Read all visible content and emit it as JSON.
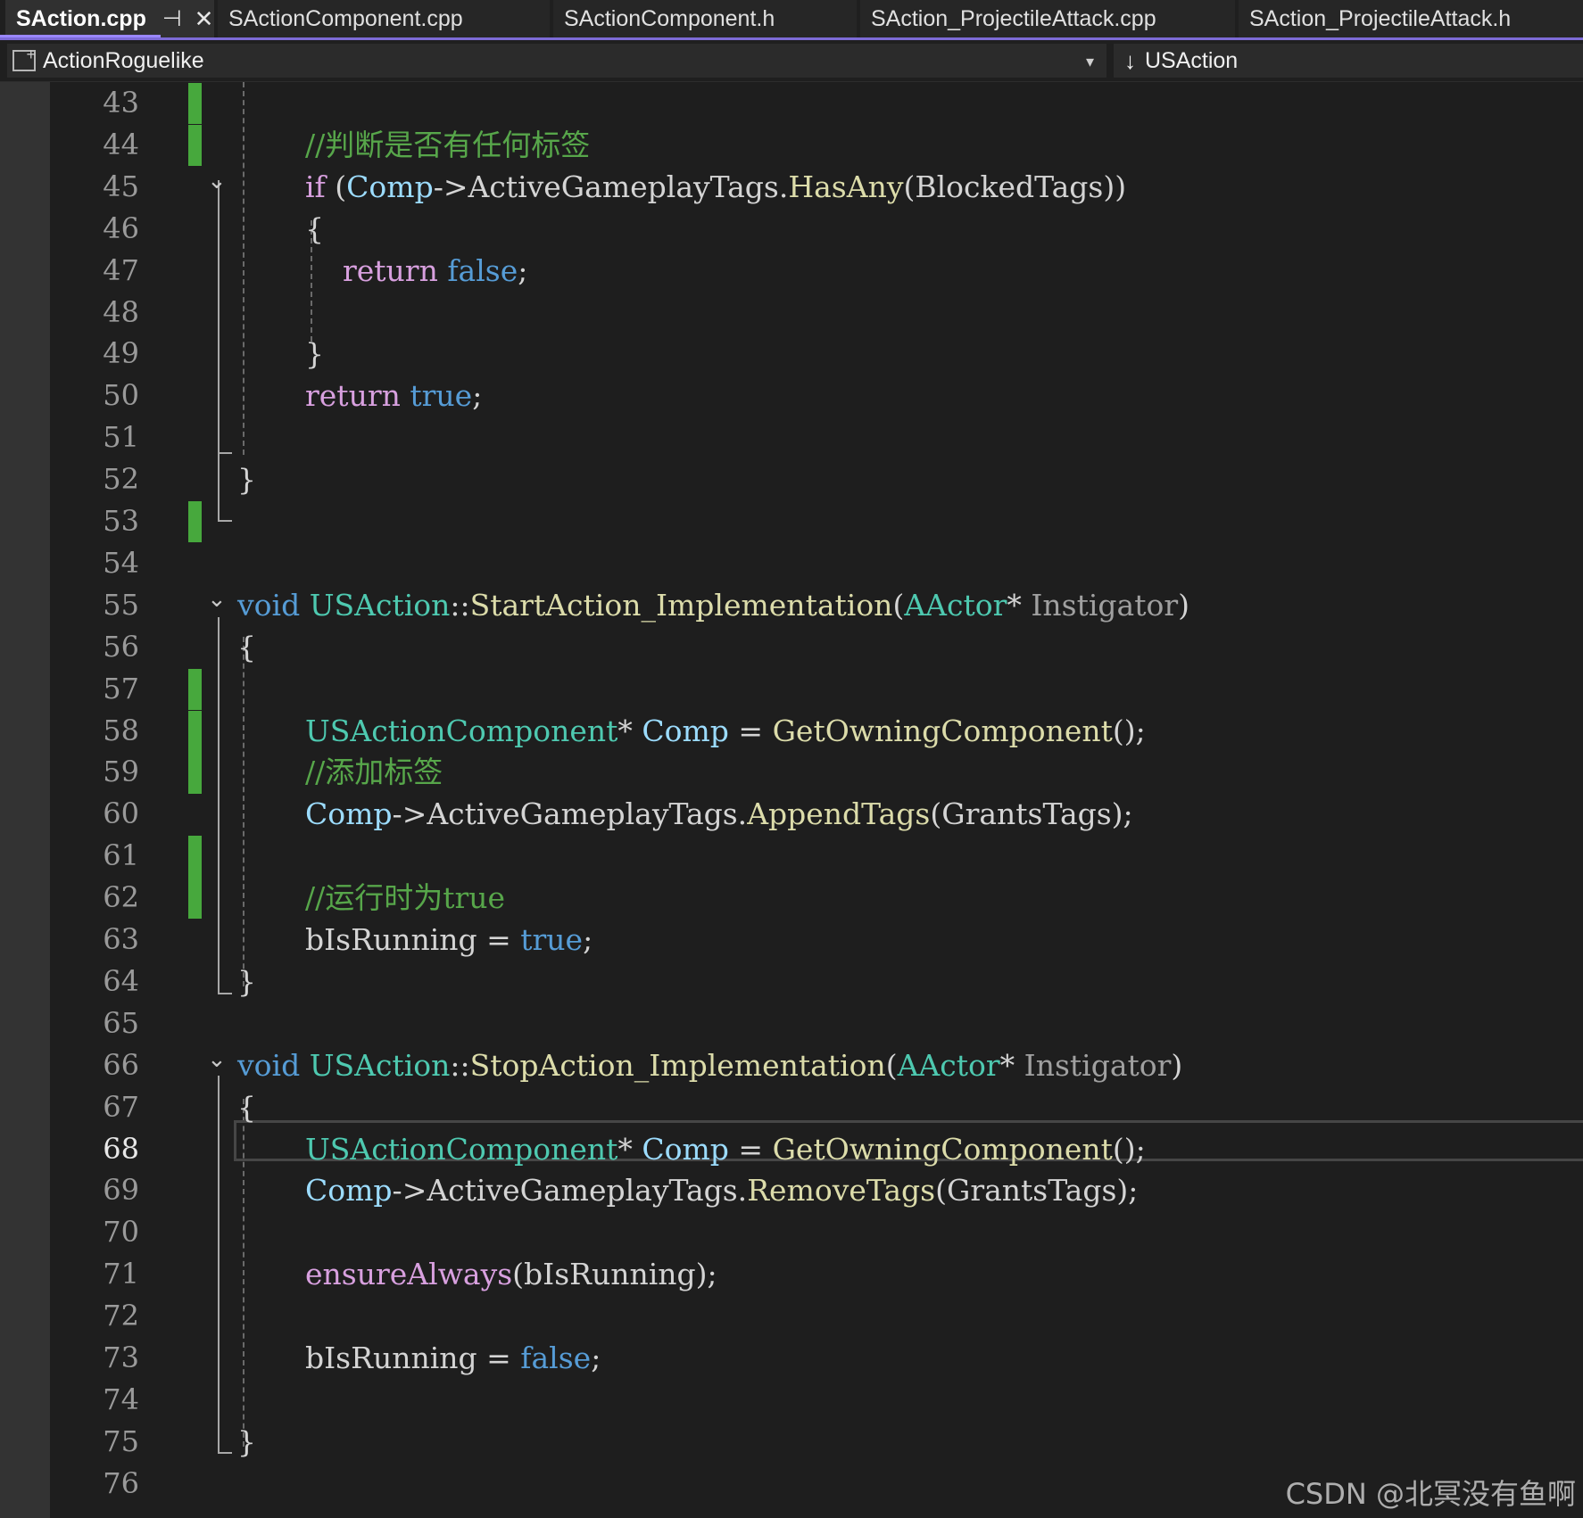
{
  "tabs": [
    {
      "label": "SAction.cpp",
      "active": true,
      "pin_icon": "pin-icon",
      "close_icon": "close-icon",
      "pin_glyph": "⊣",
      "close_glyph": "✕"
    },
    {
      "label": "SActionComponent.cpp",
      "active": false
    },
    {
      "label": "SActionComponent.h",
      "active": false
    },
    {
      "label": "SAction_ProjectileAttack.cpp",
      "active": false
    },
    {
      "label": "SAction_ProjectileAttack.h",
      "active": false
    }
  ],
  "navbar": {
    "project": "ActionRoguelike",
    "project_caret": "▾",
    "member_arrow": "↓",
    "member": "USAction"
  },
  "editor": {
    "current_line": 68,
    "lines": [
      {
        "n": 43,
        "tokens": []
      },
      {
        "n": 44,
        "tokens": [
          {
            "c": "cm",
            "t": "//判断是否有任何标签"
          }
        ]
      },
      {
        "n": 45,
        "tokens": [
          {
            "c": "ctl",
            "t": "if"
          },
          {
            "c": "plain",
            "t": " ("
          },
          {
            "c": "var",
            "t": "Comp"
          },
          {
            "c": "plain",
            "t": "->ActiveGameplayTags."
          },
          {
            "c": "fn",
            "t": "HasAny"
          },
          {
            "c": "plain",
            "t": "(BlockedTags))"
          }
        ]
      },
      {
        "n": 46,
        "tokens": [
          {
            "c": "plain",
            "t": "{"
          }
        ]
      },
      {
        "n": 47,
        "tokens": [
          {
            "c": "plain",
            "t": "    "
          },
          {
            "c": "ctl",
            "t": "return"
          },
          {
            "c": "plain",
            "t": " "
          },
          {
            "c": "kw",
            "t": "false"
          },
          {
            "c": "plain",
            "t": ";"
          }
        ]
      },
      {
        "n": 48,
        "tokens": []
      },
      {
        "n": 49,
        "tokens": [
          {
            "c": "plain",
            "t": "}"
          }
        ]
      },
      {
        "n": 50,
        "tokens": [
          {
            "c": "ctl",
            "t": "return"
          },
          {
            "c": "plain",
            "t": " "
          },
          {
            "c": "kw",
            "t": "true"
          },
          {
            "c": "plain",
            "t": ";"
          }
        ]
      },
      {
        "n": 51,
        "tokens": []
      },
      {
        "n": 52,
        "tokens": [
          {
            "c": "plain",
            "t": "}"
          }
        ]
      },
      {
        "n": 53,
        "tokens": []
      },
      {
        "n": 54,
        "tokens": []
      },
      {
        "n": 55,
        "tokens": [
          {
            "c": "kw",
            "t": "void"
          },
          {
            "c": "plain",
            "t": " "
          },
          {
            "c": "type",
            "t": "USAction"
          },
          {
            "c": "plain",
            "t": "::"
          },
          {
            "c": "fn",
            "t": "StartAction_Implementation"
          },
          {
            "c": "plain",
            "t": "("
          },
          {
            "c": "type",
            "t": "AActor"
          },
          {
            "c": "plain",
            "t": "* "
          },
          {
            "c": "param",
            "t": "Instigator"
          },
          {
            "c": "plain",
            "t": ")"
          }
        ]
      },
      {
        "n": 56,
        "tokens": [
          {
            "c": "plain",
            "t": "{"
          }
        ]
      },
      {
        "n": 57,
        "tokens": []
      },
      {
        "n": 58,
        "tokens": [
          {
            "c": "type",
            "t": "USActionComponent"
          },
          {
            "c": "plain",
            "t": "* "
          },
          {
            "c": "var",
            "t": "Comp"
          },
          {
            "c": "plain",
            "t": " = "
          },
          {
            "c": "fn",
            "t": "GetOwningComponent"
          },
          {
            "c": "plain",
            "t": "();"
          }
        ]
      },
      {
        "n": 59,
        "tokens": [
          {
            "c": "cm",
            "t": "//添加标签"
          }
        ]
      },
      {
        "n": 60,
        "tokens": [
          {
            "c": "var",
            "t": "Comp"
          },
          {
            "c": "plain",
            "t": "->ActiveGameplayTags."
          },
          {
            "c": "fn",
            "t": "AppendTags"
          },
          {
            "c": "plain",
            "t": "(GrantsTags);"
          }
        ]
      },
      {
        "n": 61,
        "tokens": []
      },
      {
        "n": 62,
        "tokens": [
          {
            "c": "cm",
            "t": "//运行时为true"
          }
        ]
      },
      {
        "n": 63,
        "tokens": [
          {
            "c": "plain",
            "t": "bIsRunning = "
          },
          {
            "c": "kw",
            "t": "true"
          },
          {
            "c": "plain",
            "t": ";"
          }
        ]
      },
      {
        "n": 64,
        "tokens": [
          {
            "c": "plain",
            "t": "}"
          }
        ]
      },
      {
        "n": 65,
        "tokens": []
      },
      {
        "n": 66,
        "tokens": [
          {
            "c": "kw",
            "t": "void"
          },
          {
            "c": "plain",
            "t": " "
          },
          {
            "c": "type",
            "t": "USAction"
          },
          {
            "c": "plain",
            "t": "::"
          },
          {
            "c": "fn",
            "t": "StopAction_Implementation"
          },
          {
            "c": "plain",
            "t": "("
          },
          {
            "c": "type",
            "t": "AActor"
          },
          {
            "c": "plain",
            "t": "* "
          },
          {
            "c": "param",
            "t": "Instigator"
          },
          {
            "c": "plain",
            "t": ")"
          }
        ]
      },
      {
        "n": 67,
        "tokens": [
          {
            "c": "plain",
            "t": "{"
          }
        ]
      },
      {
        "n": 68,
        "tokens": [
          {
            "c": "type",
            "t": "USActionComponent"
          },
          {
            "c": "plain",
            "t": "* "
          },
          {
            "c": "var",
            "t": "Comp"
          },
          {
            "c": "plain",
            "t": " = "
          },
          {
            "c": "fn",
            "t": "GetOwningComponent"
          },
          {
            "c": "plain",
            "t": "();"
          }
        ]
      },
      {
        "n": 69,
        "tokens": [
          {
            "c": "var",
            "t": "Comp"
          },
          {
            "c": "plain",
            "t": "->ActiveGameplayTags."
          },
          {
            "c": "fn",
            "t": "RemoveTags"
          },
          {
            "c": "plain",
            "t": "(GrantsTags);"
          }
        ]
      },
      {
        "n": 70,
        "tokens": []
      },
      {
        "n": 71,
        "tokens": [
          {
            "c": "ctl",
            "t": "ensureAlways"
          },
          {
            "c": "plain",
            "t": "(bIsRunning);"
          }
        ]
      },
      {
        "n": 72,
        "tokens": []
      },
      {
        "n": 73,
        "tokens": [
          {
            "c": "plain",
            "t": "bIsRunning = "
          },
          {
            "c": "kw",
            "t": "false"
          },
          {
            "c": "plain",
            "t": ";"
          }
        ]
      },
      {
        "n": 74,
        "tokens": []
      },
      {
        "n": 75,
        "tokens": [
          {
            "c": "plain",
            "t": "}"
          }
        ]
      },
      {
        "n": 76,
        "tokens": []
      }
    ],
    "changed_lines": [
      43,
      44,
      53,
      57,
      58,
      59,
      61,
      62
    ],
    "fold_markers": [
      45,
      55,
      66
    ],
    "fold_glyph": "⌄"
  },
  "colors": {
    "background": "#1e1e1e",
    "keyword": "#569cd6",
    "control": "#d8a0df",
    "type": "#4ec9b0",
    "variable": "#9cdcfe",
    "function": "#dcdcaa",
    "comment": "#57a64a",
    "change_bar": "#47a83d",
    "accent": "#7d6bd6"
  },
  "watermark": "CSDN @北冥没有鱼啊"
}
